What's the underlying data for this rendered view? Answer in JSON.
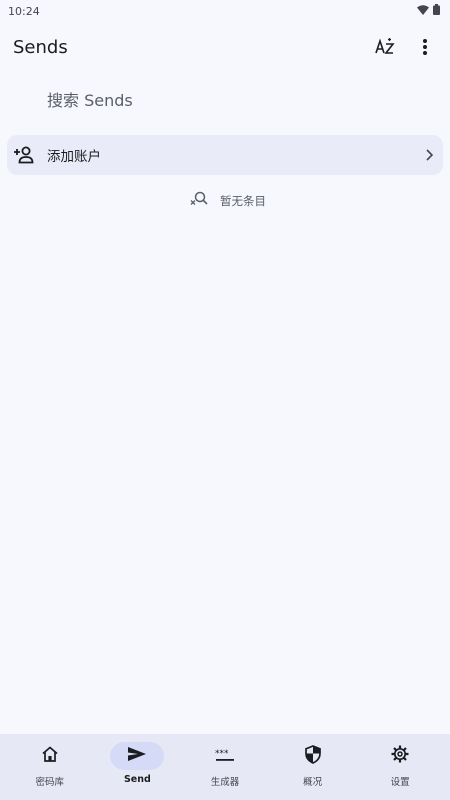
{
  "status_bar": {
    "time": "10:24",
    "icons": [
      "wifi-icon",
      "battery-icon"
    ]
  },
  "top_bar": {
    "title": "Sends",
    "actions": [
      "sort-az-icon",
      "more-vertical-icon"
    ]
  },
  "search": {
    "placeholder": "搜索 Sends",
    "value": ""
  },
  "account_row": {
    "icon": "add-person-icon",
    "label": "添加账户",
    "trailing_icon": "chevron-right-icon"
  },
  "empty_state": {
    "icon": "search-off-icon",
    "text": "暂无条目"
  },
  "bottom_nav": {
    "items": [
      {
        "label": "密码库",
        "icon": "home-icon",
        "active": false
      },
      {
        "label": "Send",
        "icon": "send-icon",
        "active": true
      },
      {
        "label": "生成器",
        "icon": "password-dots-icon",
        "active": false
      },
      {
        "label": "概况",
        "icon": "shield-icon",
        "active": false
      },
      {
        "label": "设置",
        "icon": "gear-icon",
        "active": false
      }
    ]
  },
  "colors": {
    "background": "#f6f8fe",
    "account_row_bg": "#e9ecf8",
    "nav_bg": "#e6e9f5",
    "active_pill": "#d5dbf6",
    "text_primary": "#1b1c20",
    "text_secondary": "#5b5e68"
  }
}
